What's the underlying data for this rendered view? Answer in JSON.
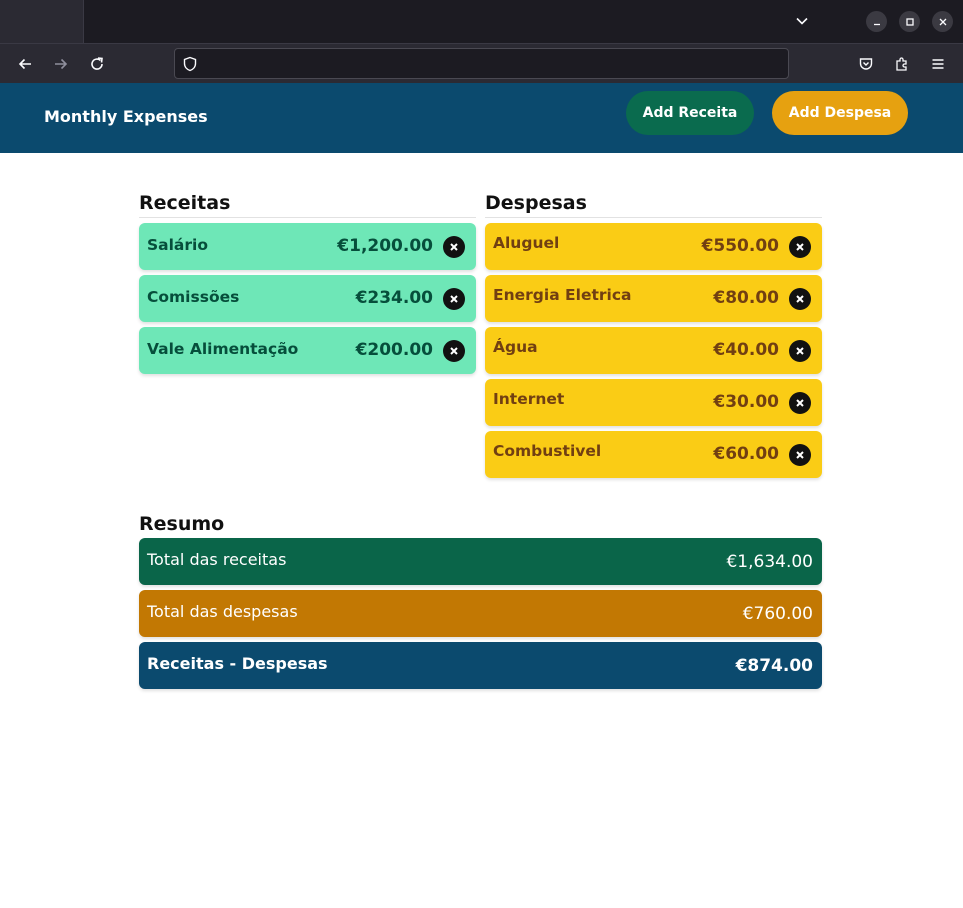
{
  "browser": {
    "url_value": "",
    "colors": {
      "titlebar": "#1c1b22",
      "toolbar": "#2b2a33"
    }
  },
  "header": {
    "title": "Monthly Expenses",
    "add_receita_label": "Add Receita",
    "add_despesa_label": "Add Despesa",
    "colors": {
      "background": "#0b4a6e",
      "receita_button": "#0a6b4e",
      "despesa_button": "#e6a110"
    }
  },
  "receitas": {
    "heading": "Receitas",
    "items": [
      {
        "name": "Salário",
        "amount": "€1,200.00"
      },
      {
        "name": "Comissões",
        "amount": "€234.00"
      },
      {
        "name": "Vale Alimentação",
        "amount": "€200.00"
      }
    ],
    "color": "#6ee7b7"
  },
  "despesas": {
    "heading": "Despesas",
    "items": [
      {
        "name": "Aluguel",
        "amount": "€550.00"
      },
      {
        "name": "Energia Eletrica",
        "amount": "€80.00"
      },
      {
        "name": "Água",
        "amount": "€40.00"
      },
      {
        "name": "Internet",
        "amount": "€30.00"
      },
      {
        "name": "Combustivel",
        "amount": "€60.00"
      }
    ],
    "color": "#facc15"
  },
  "resumo": {
    "heading": "Resumo",
    "rows": [
      {
        "label": "Total das receitas",
        "value": "€1,634.00"
      },
      {
        "label": "Total das despesas",
        "value": "€760.00"
      },
      {
        "label": "Receitas - Despesas",
        "value": "€874.00"
      }
    ]
  }
}
